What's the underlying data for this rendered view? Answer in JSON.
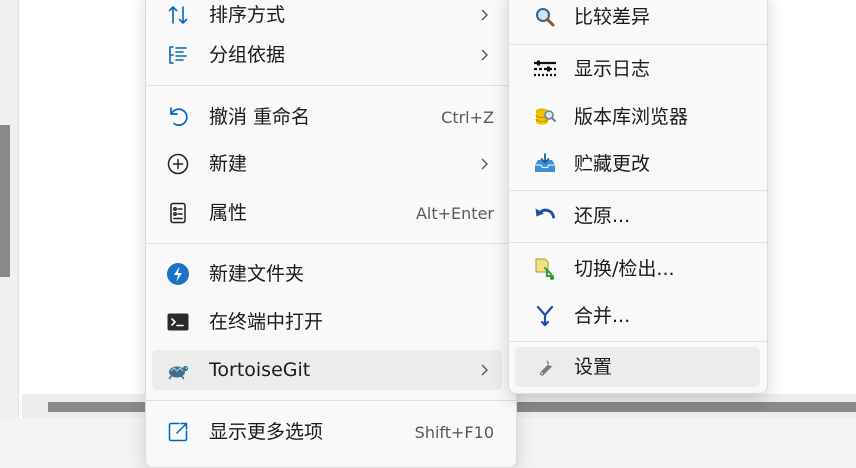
{
  "main_menu": {
    "items": [
      {
        "label": "排序方式",
        "icon": "sort-icon",
        "submenu": true
      },
      {
        "label": "分组依据",
        "icon": "group-by-icon",
        "submenu": true
      },
      {
        "label": "撤消 重命名",
        "icon": "undo-icon",
        "shortcut": "Ctrl+Z"
      },
      {
        "label": "新建",
        "icon": "new-plus-icon",
        "submenu": true
      },
      {
        "label": "属性",
        "icon": "properties-icon",
        "shortcut": "Alt+Enter"
      },
      {
        "label": "新建文件夹",
        "icon": "new-folder-icon"
      },
      {
        "label": "在终端中打开",
        "icon": "terminal-icon"
      },
      {
        "label": "TortoiseGit",
        "icon": "tortoisegit-icon",
        "submenu": true
      },
      {
        "label": "显示更多选项",
        "icon": "show-more-icon",
        "shortcut": "Shift+F10"
      }
    ]
  },
  "submenu": {
    "items": [
      {
        "label": "比较差异",
        "icon": "diff-magnifier-icon"
      },
      {
        "label": "显示日志",
        "icon": "show-log-icon"
      },
      {
        "label": "版本库浏览器",
        "icon": "repo-browser-icon"
      },
      {
        "label": "贮藏更改",
        "icon": "stash-icon"
      },
      {
        "label": "还原...",
        "icon": "revert-icon"
      },
      {
        "label": "切换/检出...",
        "icon": "switch-checkout-icon"
      },
      {
        "label": "合并...",
        "icon": "merge-icon"
      },
      {
        "label": "设置",
        "icon": "wrench-settings-icon"
      }
    ]
  },
  "colors": {
    "accent_blue": "#0067c0",
    "menu_bg": "#f9f9f9",
    "hover_bg": "#ececec"
  }
}
